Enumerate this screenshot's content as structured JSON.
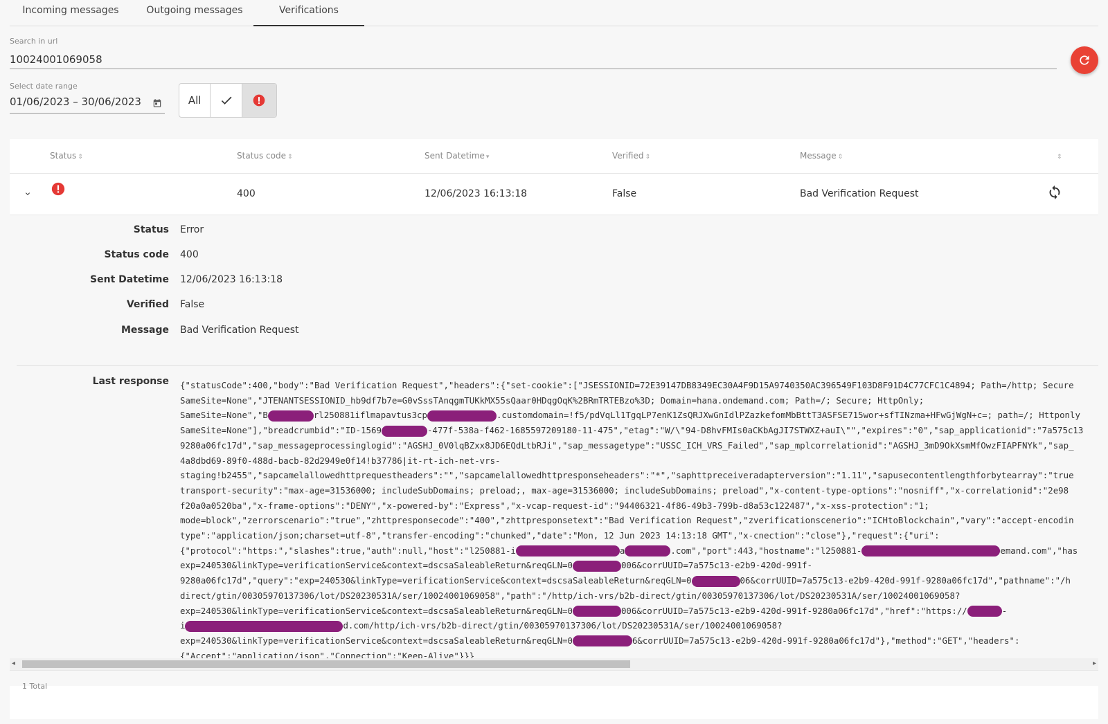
{
  "tabs": [
    {
      "label": "Incoming messages"
    },
    {
      "label": "Outgoing messages"
    },
    {
      "label": "Verifications",
      "active": true
    }
  ],
  "search": {
    "label": "Search in url",
    "value": "10024001069058"
  },
  "date_range": {
    "label": "Select date range",
    "value": "01/06/2023 – 30/06/2023"
  },
  "filters": {
    "all_label": "All",
    "selected": "error"
  },
  "table": {
    "columns": [
      "Status",
      "Status code",
      "Sent Datetime",
      "Verified",
      "Message"
    ],
    "rows": [
      {
        "status": "error",
        "status_code": "400",
        "sent_datetime": "12/06/2023 16:13:18",
        "verified": "False",
        "message": "Bad Verification Request"
      }
    ],
    "total": "1 Total"
  },
  "detail": {
    "labels": {
      "status": "Status",
      "status_code": "Status code",
      "sent_datetime": "Sent Datetime",
      "verified": "Verified",
      "message": "Message",
      "last_response": "Last response"
    },
    "values": {
      "status": "Error",
      "status_code": "400",
      "sent_datetime": "12/06/2023 16:13:18",
      "verified": "False",
      "message": "Bad Verification Request"
    },
    "last_response_lines": [
      [
        "{\"statusCode\":400,\"body\":\"Bad Verification Request\",\"headers\":{\"set-cookie\":[\"JSESSIONID=72E39147DB8349EC30A4F9D15A9740350AC396549F103D8F91D4C77CFC1C4894; Path=/http; Secure"
      ],
      [
        "SameSite=None\",\"JTENANTSESSIONID_hb9df7b7e=G0vSssTAnqgmTUKkMX55sQaar0HDqgOqK%2BRmTRTEBzo%3D; Domain=hana.ondemand.com; Path=/; Secure; HttpOnly;"
      ],
      [
        "SameSite=None\",\"B",
        {
          "r": 66
        },
        "rl250881iflmapavtus3cp",
        {
          "r": 100
        },
        ".customdomain=!f5/pdVqLl1TgqLP7enK1ZsQRJXwGnIdlPZazkefomMbBttT3ASFSE715wor+sfTINzma+HFwGjWgN+c=; path=/; Httponly"
      ],
      [
        "SameSite=None\"],\"breadcrumbid\":\"ID-1569",
        {
          "r": 66
        },
        "-477f-538a-f462-1685597209180-11-475\",\"etag\":\"W/\\\"94-D8hvFMIs0aCKbAgJI7STWXZ+auI\\\"\",\"expires\":\"0\",\"sap_applicationid\":\"7a575c13"
      ],
      [
        "9280a06fc17d\",\"sap_messageprocessinglogid\":\"AGSHJ_0V0lqBZxx8JD6EQdLtbRJi\",\"sap_messagetype\":\"USSC_ICH_VRS_Failed\",\"sap_mplcorrelationid\":\"AGSHJ_3mD9OkXsmMfOwzFIAPFNYk\",\"sap_"
      ],
      [
        "4a8dbd69-89f0-488d-bacb-82d2949e0f14!b37786|it-rt-ich-net-vrs-"
      ],
      [
        "staging!b2455\",\"sapcamelallowedhttprequestheaders\":\"\",\"sapcamelallowedhttpresponseheaders\":\"*\",\"saphttpreceiveradapterversion\":\"1.11\",\"sapusecontentlengthforbytearray\":\"true"
      ],
      [
        "transport-security\":\"max-age=31536000; includeSubDomains; preload;, max-age=31536000; includeSubDomains; preload\",\"x-content-type-options\":\"nosniff\",\"x-correlationid\":\"2e98"
      ],
      [
        "f20a0a0520ba\",\"x-frame-options\":\"DENY\",\"x-powered-by\":\"Express\",\"x-vcap-request-id\":\"94406321-4f86-49b3-799b-d8a53c122487\",\"x-xss-protection\":\"1;"
      ],
      [
        "mode=block\",\"zerrorscenario\":\"true\",\"zhttpresponsecode\":\"400\",\"zhttpresponsetext\":\"Bad Verification Request\",\"zverificationscenerio\":\"ICHtoBlockchain\",\"vary\":\"accept-encodin"
      ],
      [
        "type\":\"application/json;charset=utf-8\",\"transfer-encoding\":\"chunked\",\"date\":\"Mon, 12 Jun 2023 14:13:18 GMT\",\"x-cnection\":\"close\"},\"request\":{\"uri\":"
      ],
      [
        "{\"protocol\":\"https:\",\"slashes\":true,\"auth\":null,\"host\":\"l250881-i",
        {
          "r": 150
        },
        "a",
        {
          "r": 66
        },
        ".com\",\"port\":443,\"hostname\":\"l250881-",
        {
          "r": 200
        },
        "emand.com\",\"has"
      ],
      [
        "exp=240530&linkType=verificationService&context=dscsaSaleableReturn&reqGLN=0",
        {
          "r": 70
        },
        "006&corrUUID=7a575c13-e2b9-420d-991f-"
      ],
      [
        "9280a06fc17d\",\"query\":\"exp=240530&linkType=verificationService&context=dscsaSaleableReturn&reqGLN=0",
        {
          "r": 70
        },
        "06&corrUUID=7a575c13-e2b9-420d-991f-9280a06fc17d\",\"pathname\":\"/h"
      ],
      [
        "direct/gtin/00305970137306/lot/DS20230531A/ser/10024001069058\",\"path\":\"/http/ich-vrs/b2b-direct/gtin/00305970137306/lot/DS20230531A/ser/10024001069058?"
      ],
      [
        "exp=240530&linkType=verificationService&context=dscsaSaleableReturn&reqGLN=0",
        {
          "r": 70
        },
        "006&corrUUID=7a575c13-e2b9-420d-991f-9280a06fc17d\",\"href\":\"https://",
        {
          "r": 50
        },
        "-"
      ],
      [
        "i",
        {
          "r": 228
        },
        "d.com/http/ich-vrs/b2b-direct/gtin/00305970137306/lot/DS20230531A/ser/10024001069058?"
      ],
      [
        "exp=240530&linkType=verificationService&context=dscsaSaleableReturn&reqGLN=0",
        {
          "r": 86
        },
        "6&corrUUID=7a575c13-e2b9-420d-991f-9280a06fc17d\"},\"method\":\"GET\",\"headers\":"
      ],
      [
        "{\"Accept\":\"application/json\",\"Connection\":\"Keep-Alive\"}}}"
      ]
    ]
  },
  "colors": {
    "error": "#e53935",
    "fab": "#e94235",
    "redaction": "#8b1f7a"
  },
  "icons": {
    "refresh": "refresh-icon",
    "calendar": "calendar-icon",
    "check": "check-icon",
    "error": "error-icon",
    "expand": "chevron-down-icon",
    "retry": "retry-icon"
  }
}
